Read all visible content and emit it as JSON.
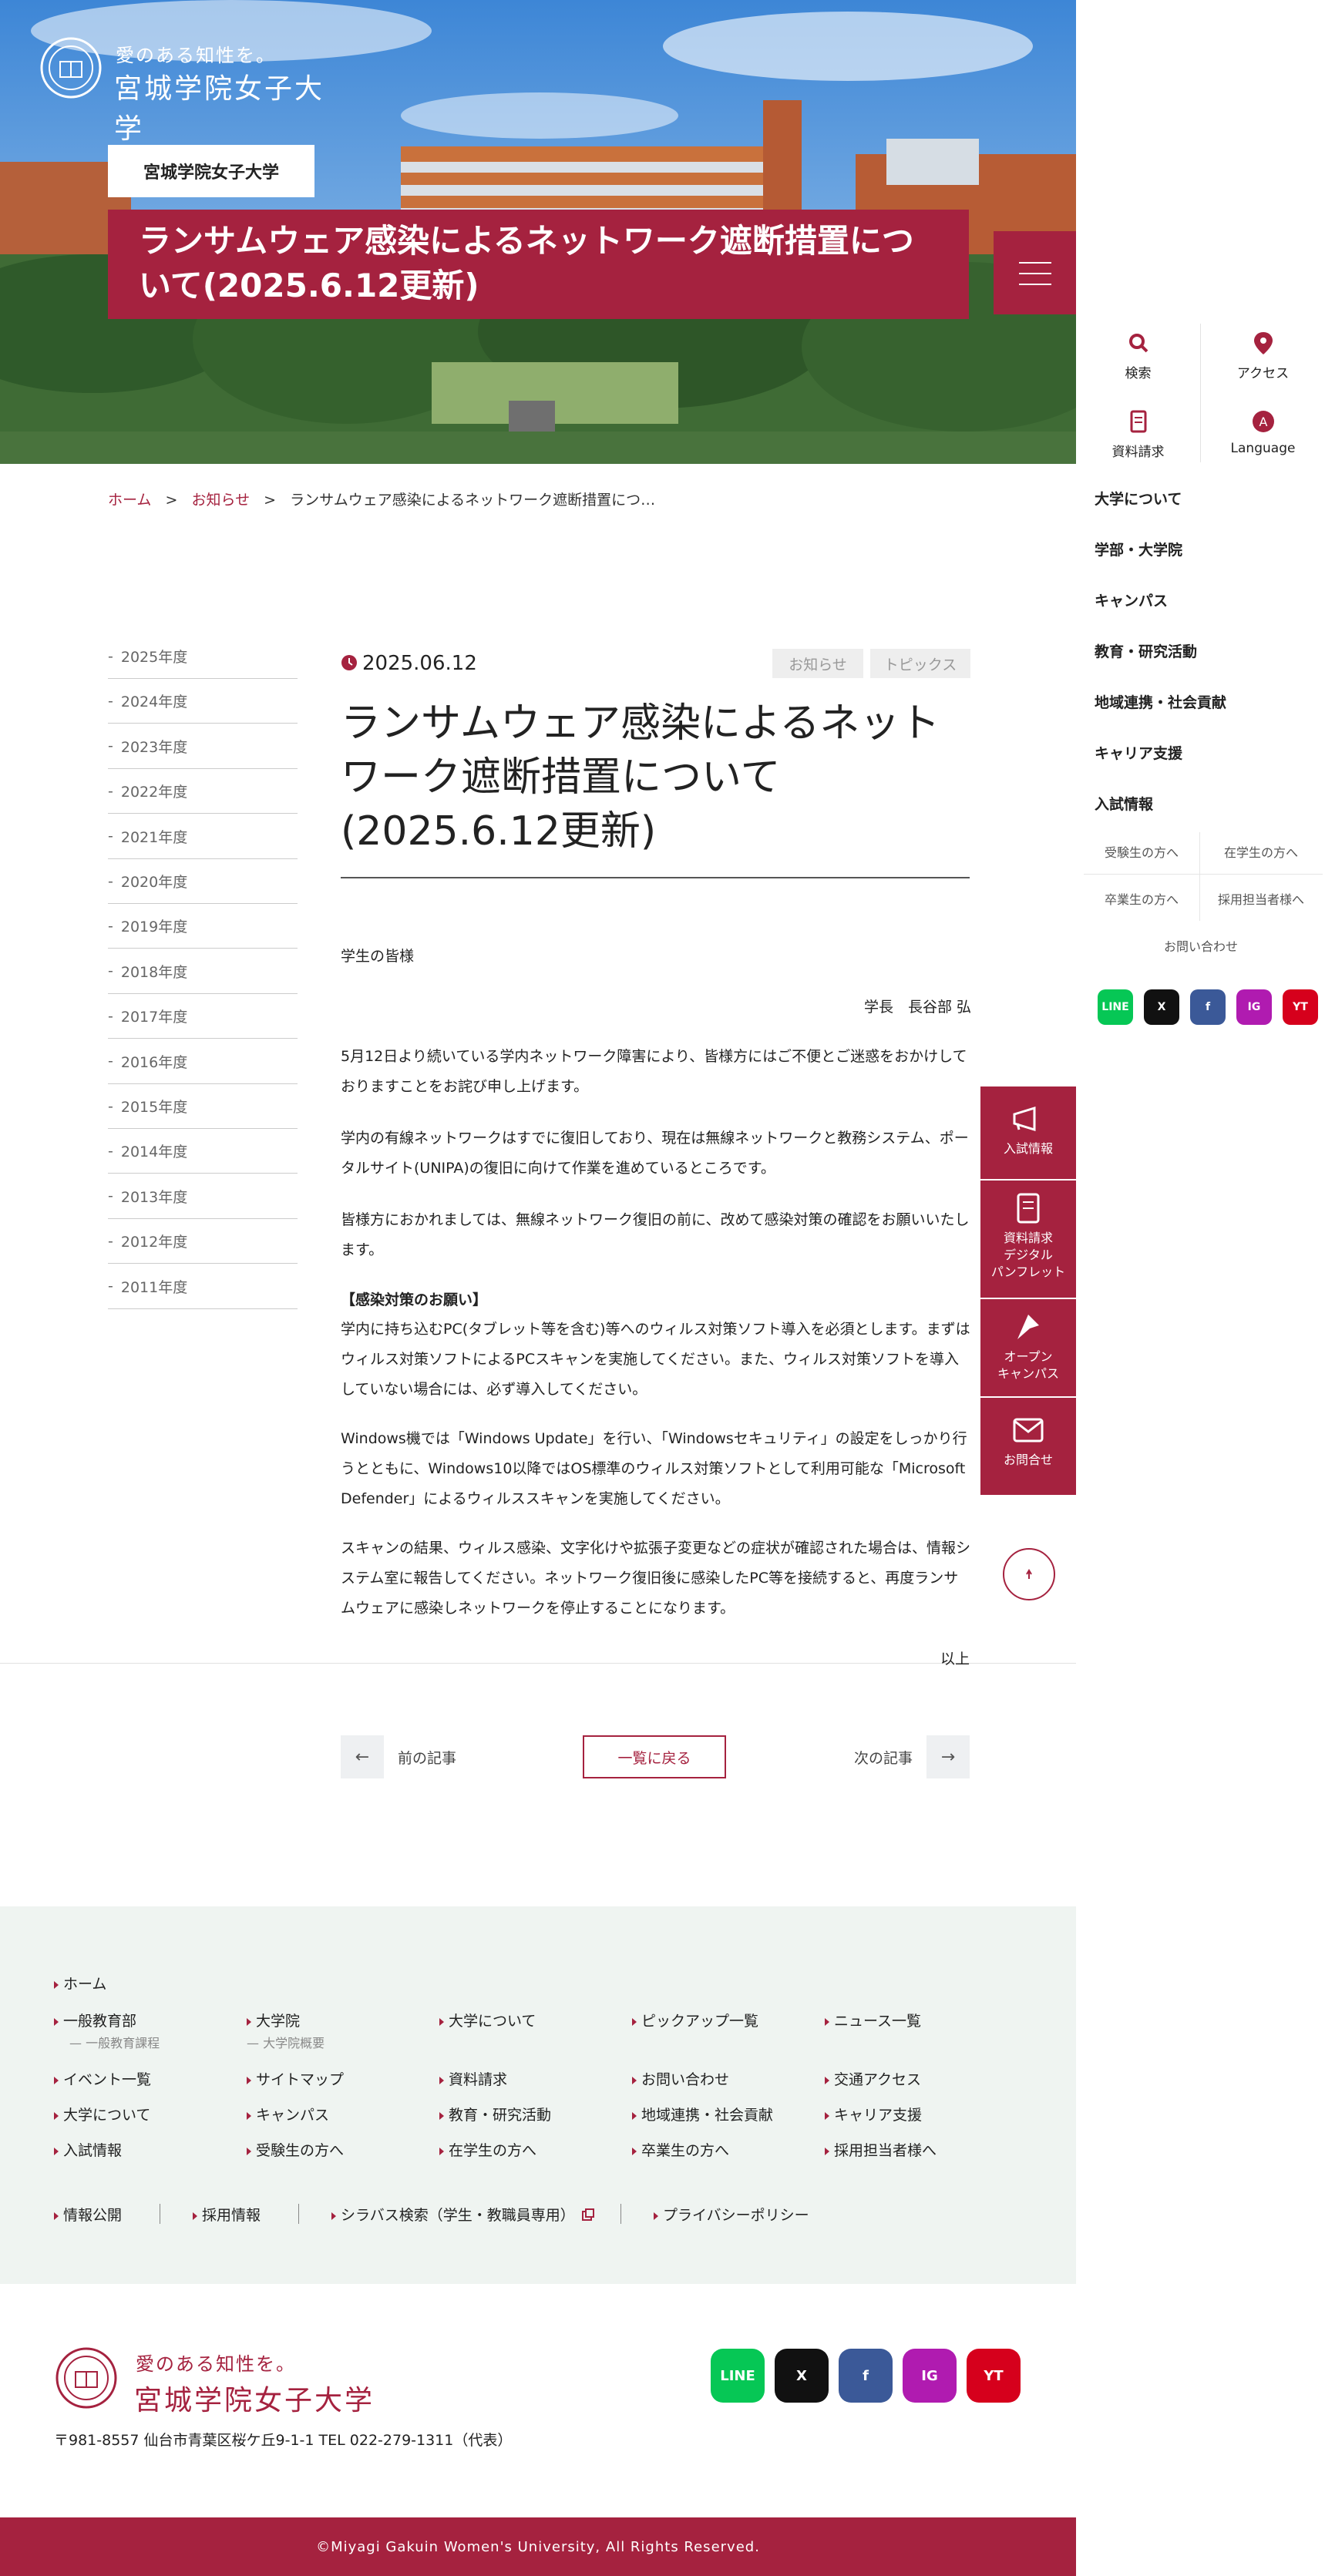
{
  "header": {
    "logo_tagline": "愛のある知性を。",
    "logo_name": "宮城学院女子大学",
    "uni_label": "宮城学院女子大学",
    "page_title": "ランサムウェア感染によるネットワーク遮断措置について(2025.6.12更新)"
  },
  "rail": {
    "search": "検索",
    "access": "アクセス",
    "request": "資料請求",
    "language": "Language",
    "nav": [
      "大学について",
      "学部・大学院",
      "キャンパス",
      "教育・研究活動",
      "地域連携・社会貢献",
      "キャリア支援",
      "入試情報"
    ],
    "sub": [
      "受験生の方へ",
      "在学生の方へ",
      "卒業生の方へ",
      "採用担当者様へ"
    ],
    "contact": "お問い合わせ",
    "social": [
      "LINE",
      "X",
      "f",
      "IG",
      "YT"
    ]
  },
  "breadcrumb": {
    "home": "ホーム",
    "news": "お知らせ",
    "sep": ">",
    "current": "ランサムウェア感染によるネットワーク遮断措置につ…"
  },
  "years": [
    "2025年度",
    "2024年度",
    "2023年度",
    "2022年度",
    "2021年度",
    "2020年度",
    "2019年度",
    "2018年度",
    "2017年度",
    "2016年度",
    "2015年度",
    "2014年度",
    "2013年度",
    "2012年度",
    "2011年度"
  ],
  "year_dash": "-",
  "article": {
    "date": "2025.06.12",
    "tags": [
      "お知らせ",
      "トピックス"
    ],
    "title": "ランサムウェア感染によるネットワーク遮断措置について(2025.6.12更新)",
    "greeting": "学生の皆様",
    "signature": "学長　長谷部 弘",
    "p1": "5月12日より続いている学内ネットワーク障害により、皆様方にはご不便とご迷惑をおかけしておりますことをお詫び申し上げます。",
    "p2": "学内の有線ネットワークはすでに復旧しており、現在は無線ネットワークと教務システム、ポータルサイト(UNIPA)の復旧に向けて作業を進めているところです。",
    "p3": "皆様方におかれましては、無線ネットワーク復旧の前に、改めて感染対策の確認をお願いいたします。",
    "p4_head": "【感染対策のお願い】",
    "p4": "学内に持ち込むPC(タブレット等を含む)等へのウィルス対策ソフト導入を必須とします。まずはウィルス対策ソフトによるPCスキャンを実施してください。また、ウィルス対策ソフトを導入していない場合には、必ず導入してください。",
    "p5": "Windows機では「Windows Update」を行い、「Windowsセキュリティ」の設定をしっかり行うとともに、Windows10以降ではOS標準のウィルス対策ソフトとして利用可能な「Microsoft Defender」によるウィルススキャンを実施してください。",
    "p6": "スキャンの結果、ウィルス感染、文字化けや拡張子変更などの症状が確認された場合は、情報システム室に報告してください。ネットワーク復旧後に感染したPC等を接続すると、再度ランサムウェアに感染しネットワークを停止することになります。",
    "end": "以上"
  },
  "pager": {
    "prev": "前の記事",
    "list": "一覧に戻る",
    "next": "次の記事",
    "prev_arrow": "←",
    "next_arrow": "→"
  },
  "float": {
    "admission": "入試情報",
    "request": "資料請求\nデジタル\nパンフレット",
    "campus": "オープン\nキャンパス",
    "contact": "お問合せ"
  },
  "footer": {
    "home": "ホーム",
    "col1": [
      "一般教育部",
      "イベント一覧",
      "大学について",
      "入試情報"
    ],
    "col1_sub": "一般教育課程",
    "col2": [
      "大学院",
      "サイトマップ",
      "キャンパス",
      "受験生の方へ"
    ],
    "col2_sub": "大学院概要",
    "col3": [
      "大学について",
      "資料請求",
      "教育・研究活動",
      "在学生の方へ"
    ],
    "col4": [
      "ピックアップ一覧",
      "お問い合わせ",
      "地域連携・社会貢献",
      "卒業生の方へ"
    ],
    "col5": [
      "ニュース一覧",
      "交通アクセス",
      "キャリア支援",
      "採用担当者様へ"
    ],
    "bottom": [
      "情報公開",
      "採用情報",
      "シラバス検索（学生・教職員専用）",
      "プライバシーポリシー"
    ],
    "logo_tagline": "愛のある知性を。",
    "logo_name": "宮城学院女子大学",
    "address": "〒981-8557 仙台市青葉区桜ケ丘9-1-1 TEL 022-279-1311（代表）",
    "social": [
      "LINE",
      "X",
      "f",
      "IG",
      "YT"
    ],
    "copyright": "©Miyagi Gakuin Women's University, All Rights Reserved."
  },
  "colors": {
    "brand": "#a5223f",
    "footer_bg": "#eff4f1"
  }
}
